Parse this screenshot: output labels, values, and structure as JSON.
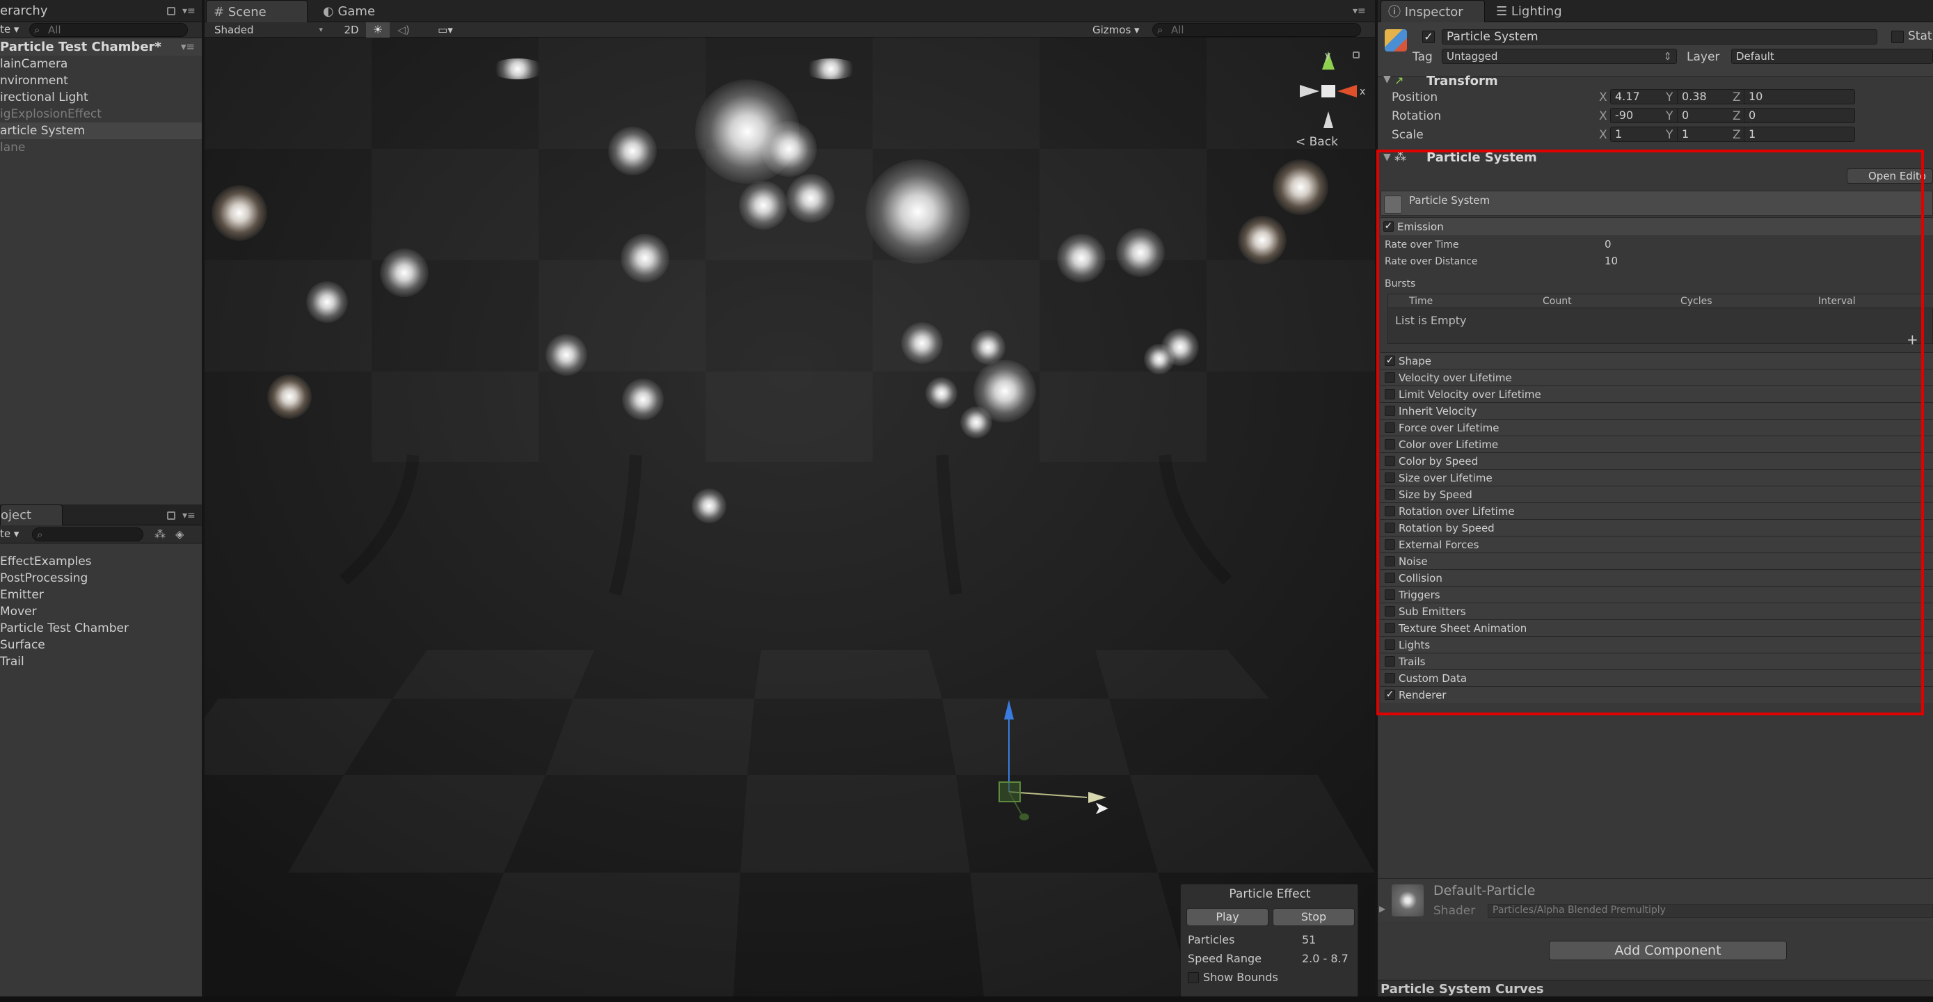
{
  "hierarchy": {
    "tab_label": "erarchy",
    "create_label": "te ▾",
    "search_placeholder": "All",
    "scene_name": "Particle Test Chamber*",
    "items": [
      {
        "label": "lainCamera",
        "dim": false,
        "selected": false
      },
      {
        "label": "nvironment",
        "dim": false,
        "selected": false
      },
      {
        "label": "irectional Light",
        "dim": false,
        "selected": false
      },
      {
        "label": "igExplosionEffect",
        "dim": true,
        "selected": false
      },
      {
        "label": "article System",
        "dim": false,
        "selected": true
      },
      {
        "label": "lane",
        "dim": true,
        "selected": false
      }
    ]
  },
  "project": {
    "tab_label": "oject",
    "create_label": "te ▾",
    "items": [
      "EffectExamples",
      "PostProcessing",
      "Emitter",
      "Mover",
      "Particle Test Chamber",
      "Surface",
      "Trail"
    ]
  },
  "scene_view": {
    "tabs": [
      "Scene",
      "Game"
    ],
    "shading_mode": "Shaded",
    "toggle_2d": "2D",
    "gizmos_label": "Gizmos ▾",
    "search_placeholder": "All",
    "gizmo_back_label": "< Back",
    "axis_y": "y",
    "axis_x": "x",
    "particle_effect": {
      "title": "Particle Effect",
      "play_label": "Play",
      "stop_label": "Stop",
      "particles_label": "Particles",
      "particles_value": "51",
      "speed_range_label": "Speed Range",
      "speed_range_value": "2.0 - 8.7",
      "show_bounds_label": "Show Bounds"
    }
  },
  "inspector": {
    "tabs": [
      "Inspector",
      "Lighting"
    ],
    "object_name": "Particle System",
    "static_label": "Stat",
    "tag_label": "Tag",
    "tag_value": "Untagged",
    "layer_label": "Layer",
    "layer_value": "Default",
    "transform": {
      "title": "Transform",
      "rows": [
        {
          "label": "Position",
          "x": "4.17",
          "y": "0.38",
          "z": "10"
        },
        {
          "label": "Rotation",
          "x": "-90",
          "y": "0",
          "z": "0"
        },
        {
          "label": "Scale",
          "x": "1",
          "y": "1",
          "z": "1"
        }
      ]
    },
    "particle_system": {
      "title": "Particle System",
      "open_editor_label": "Open Edito",
      "sub_title": "Particle System",
      "emission_label": "Emission",
      "rate_over_time_label": "Rate over Time",
      "rate_over_time_value": "0",
      "rate_over_distance_label": "Rate over Distance",
      "rate_over_distance_value": "10",
      "bursts_label": "Bursts",
      "bursts_columns": [
        "Time",
        "Count",
        "Cycles",
        "Interval"
      ],
      "bursts_empty": "List is Empty",
      "modules": [
        {
          "label": "Shape",
          "checked": true
        },
        {
          "label": "Velocity over Lifetime",
          "checked": false
        },
        {
          "label": "Limit Velocity over Lifetime",
          "checked": false
        },
        {
          "label": "Inherit Velocity",
          "checked": false
        },
        {
          "label": "Force over Lifetime",
          "checked": false
        },
        {
          "label": "Color over Lifetime",
          "checked": false
        },
        {
          "label": "Color by Speed",
          "checked": false
        },
        {
          "label": "Size over Lifetime",
          "checked": false
        },
        {
          "label": "Size by Speed",
          "checked": false
        },
        {
          "label": "Rotation over Lifetime",
          "checked": false
        },
        {
          "label": "Rotation by Speed",
          "checked": false
        },
        {
          "label": "External Forces",
          "checked": false
        },
        {
          "label": "Noise",
          "checked": false
        },
        {
          "label": "Collision",
          "checked": false
        },
        {
          "label": "Triggers",
          "checked": false
        },
        {
          "label": "Sub Emitters",
          "checked": false
        },
        {
          "label": "Texture Sheet Animation",
          "checked": false
        },
        {
          "label": "Lights",
          "checked": false
        },
        {
          "label": "Trails",
          "checked": false
        },
        {
          "label": "Custom Data",
          "checked": false
        },
        {
          "label": "Renderer",
          "checked": true
        }
      ]
    },
    "material": {
      "name": "Default-Particle",
      "shader_label": "Shader",
      "shader_value": "Particles/Alpha Blended Premultiply"
    },
    "add_component_label": "Add Component",
    "curves_label": "Particle System Curves"
  },
  "colors": {
    "highlight_box": "#e00000",
    "panel_bg": "#383838",
    "scene_bg": "#202020",
    "gizmo_y": "#8fd14f",
    "gizmo_x": "#e0502a",
    "gizmo_z": "#3a7be0"
  }
}
